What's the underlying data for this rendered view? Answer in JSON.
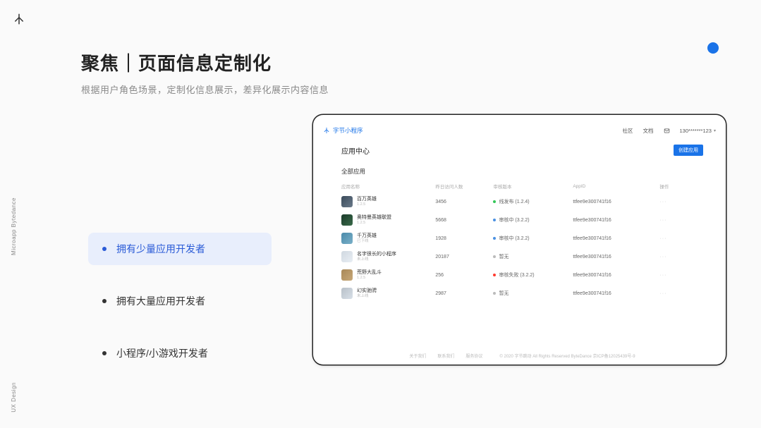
{
  "side_labels": {
    "top": "Microapp Bytedance",
    "bottom": "UX Design"
  },
  "heading": {
    "title": "聚焦｜页面信息定制化",
    "subtitle": "根据用户角色场景，定制化信息展示，差异化展示内容信息"
  },
  "bullets": [
    {
      "label": "拥有少量应用开发者",
      "active": true
    },
    {
      "label": "拥有大量应用开发者",
      "active": false
    },
    {
      "label": "小程序/小游戏开发者",
      "active": false
    }
  ],
  "app": {
    "brand": "字节小程序",
    "nav": {
      "community": "社区",
      "docs": "文档"
    },
    "user": "130*******123",
    "page_title": "应用中心",
    "create_button": "创建应用",
    "section_title": "全部应用",
    "columns": {
      "name": "应用名称",
      "visits": "昨日访问人数",
      "version": "审核版本",
      "appid": "AppID",
      "op": "操作"
    },
    "rows": [
      {
        "name": "百万英雄",
        "sub": "1.2.5",
        "visits": "3456",
        "status_color": "green",
        "status": "线发布 (1.2.4)",
        "appid": "ttfee9e300741f16",
        "thumb": "t1"
      },
      {
        "name": "奥特曼英雄联盟",
        "sub": "1.2.5",
        "visits": "5668",
        "status_color": "blue",
        "status": "审核中 (3.2.2)",
        "appid": "ttfee9e300741f16",
        "thumb": "t2"
      },
      {
        "name": "千万英雄",
        "sub": "已下线",
        "visits": "1928",
        "status_color": "blue",
        "status": "审核中 (3.2.2)",
        "appid": "ttfee9e300741f16",
        "thumb": "t3"
      },
      {
        "name": "名字很长的小程序",
        "sub": "未上线",
        "visits": "20187",
        "status_color": "gray",
        "status": "暂无",
        "appid": "ttfee9e300741f16",
        "thumb": "t4"
      },
      {
        "name": "荒野大乱斗",
        "sub": "1.2.5",
        "visits": "256",
        "status_color": "red",
        "status": "审核失败 (3.2.2)",
        "appid": "ttfee9e300741f16",
        "thumb": "t5"
      },
      {
        "name": "幻实驰骋",
        "sub": "未上线",
        "visits": "2987",
        "status_color": "gray",
        "status": "暂无",
        "appid": "ttfee9e300741f16",
        "thumb": "t6"
      }
    ],
    "footer": {
      "about": "关于我们",
      "contact": "联系我们",
      "terms": "服务协议",
      "copyright": "© 2020 字节跳动 All Rights Reserved ByteDance 京ICP备12025439号-9"
    }
  }
}
